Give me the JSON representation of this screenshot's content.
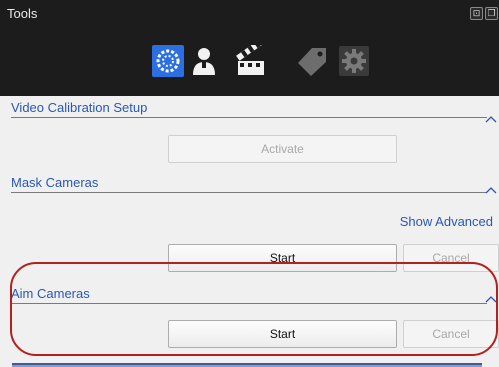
{
  "window": {
    "title": "Tools"
  },
  "toolbar": {
    "tools": [
      {
        "name": "calibration",
        "icon": "calibration-icon",
        "active": true
      },
      {
        "name": "person",
        "icon": "person-icon",
        "active": false
      },
      {
        "name": "clapper",
        "icon": "clapperboard-icon",
        "active": false
      },
      {
        "name": "tag",
        "icon": "tag-icon",
        "active": false,
        "disabled": true
      },
      {
        "name": "settings",
        "icon": "gear-icon",
        "active": false,
        "disabled": true
      }
    ]
  },
  "sections": {
    "video_calibration": {
      "title": "Video Calibration Setup",
      "activate_label": "Activate"
    },
    "mask_cameras": {
      "title": "Mask Cameras",
      "show_advanced_label": "Show Advanced",
      "start_label": "Start",
      "cancel_label": "Cancel"
    },
    "aim_cameras": {
      "title": "Aim Cameras",
      "start_label": "Start",
      "cancel_label": "Cancel"
    }
  },
  "colors": {
    "accent": "#2a57b5",
    "highlight": "#b3201f",
    "active_tool": "#2b6fe0",
    "toolbar_bg": "#1c1c1c"
  }
}
